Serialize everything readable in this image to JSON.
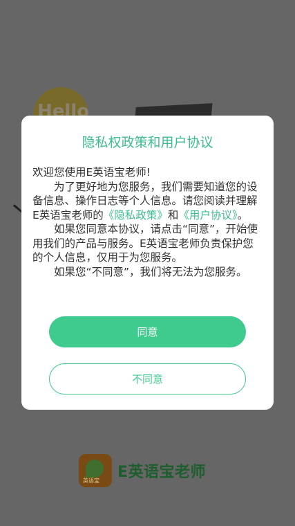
{
  "background": {
    "hello_text": "Hello"
  },
  "brand": {
    "name": "E英语宝老师",
    "logo_caption": "英语宝",
    "color": "#1e5e2e"
  },
  "dialog": {
    "title": "隐私权政策和用户协议",
    "greeting": "欢迎您使用E英语宝老师!",
    "para1_text": "为了更好地为您服务，我们需要知道您的设备信息、操作日志等个人信息。请您阅读并理解E英语宝老师的",
    "privacy_link": "《隐私政策》",
    "and_text": "和",
    "user_agreement_link": "《用户协议》",
    "para1_end": "。",
    "para2": "如果您同意本协议，请点击“同意”，开始使用我们的产品与服务。E英语宝老师负责保护您的个人信息，仅用于为您服务。",
    "para3": "如果您“不同意”，我们将无法为您服务。",
    "agree_label": "同意",
    "disagree_label": "不同意",
    "accent_color": "#3dbe8e"
  }
}
